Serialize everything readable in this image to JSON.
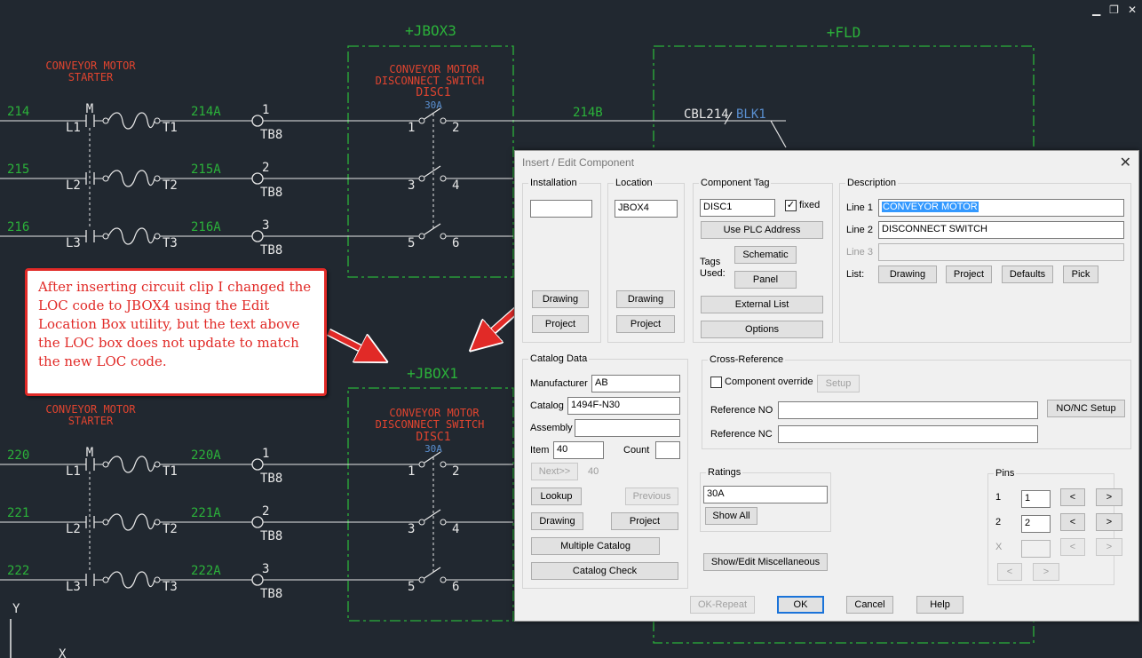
{
  "window_controls": {
    "minimize": "▁",
    "restore": "❐",
    "close": "✕"
  },
  "cad": {
    "rung_labels": [
      "CONVEYOR MOTOR",
      "STARTER"
    ],
    "box_names": {
      "jbox3": "+JBOX3",
      "fld": "+FLD",
      "jbox1": "+JBOX1"
    },
    "disc_labels": [
      "CONVEYOR MOTOR",
      "DISCONNECT SWITCH"
    ],
    "disc_tag": "DISC1",
    "rating": "30A",
    "cable_label": "CBL214",
    "wire_color": "BLK1",
    "wire_214b": "214B",
    "contactor_tag": "M",
    "top_wires": [
      "214",
      "215",
      "216"
    ],
    "top_wires_a": [
      "214A",
      "215A",
      "216A"
    ],
    "bot_wires": [
      "220",
      "221",
      "222"
    ],
    "bot_wires_a": [
      "220A",
      "221A",
      "222A"
    ],
    "line_terms": [
      "L1",
      "L2",
      "L3"
    ],
    "load_terms": [
      "T1",
      "T2",
      "T3"
    ],
    "tb_nums": [
      "1",
      "2",
      "3"
    ],
    "tb_name": "TB8",
    "pole_in": [
      "1",
      "3",
      "5"
    ],
    "pole_out": [
      "2",
      "4",
      "6"
    ],
    "ucs_y": "Y",
    "ucs_x": "X"
  },
  "callout_text": "After inserting circuit clip I changed the LOC code to JBOX4 using the Edit Location Box utility, but the text above the LOC box does not update to match the new LOC code.",
  "dialog": {
    "title": "Insert / Edit Component",
    "close": "✕",
    "installation": {
      "label": "Installation",
      "value": "",
      "drawing": "Drawing",
      "project": "Project"
    },
    "location": {
      "label": "Location",
      "value": "JBOX4",
      "drawing": "Drawing",
      "project": "Project"
    },
    "component_tag": {
      "label": "Component Tag",
      "value": "DISC1",
      "fixed_label": "fixed",
      "fixed_mark": "✓",
      "use_plc": "Use PLC Address",
      "tags_used": "Tags Used:",
      "schematic": "Schematic",
      "panel": "Panel",
      "external_list": "External List",
      "options": "Options"
    },
    "description": {
      "label": "Description",
      "line1_label": "Line 1",
      "line1": "CONVEYOR MOTOR",
      "line2_label": "Line 2",
      "line2": "DISCONNECT SWITCH",
      "line3_label": "Line 3",
      "line3": "",
      "list_label": "List:",
      "drawing": "Drawing",
      "project": "Project",
      "defaults": "Defaults",
      "pick": "Pick"
    },
    "catalog": {
      "label": "Catalog Data",
      "manufacturer_label": "Manufacturer",
      "manufacturer": "AB",
      "catalog_label": "Catalog",
      "catalog": "1494F-N30",
      "assembly_label": "Assembly",
      "assembly": "",
      "item_label": "Item",
      "item": "40",
      "count_label": "Count",
      "count": "",
      "next": "Next>>",
      "next_value": "40",
      "lookup": "Lookup",
      "previous": "Previous",
      "drawing": "Drawing",
      "project": "Project",
      "multiple": "Multiple Catalog",
      "check": "Catalog Check"
    },
    "crossref": {
      "label": "Cross-Reference",
      "override_label": "Component override",
      "setup": "Setup",
      "ref_no_label": "Reference NO",
      "ref_no": "",
      "nonc_setup": "NO/NC Setup",
      "ref_nc_label": "Reference NC",
      "ref_nc": ""
    },
    "ratings": {
      "label": "Ratings",
      "value": "30A",
      "show_all": "Show All"
    },
    "misc": "Show/Edit Miscellaneous",
    "pins": {
      "label": "Pins",
      "row1_label": "1",
      "row1": "1",
      "row2_label": "2",
      "row2": "2",
      "row3_label": "X",
      "row3": "",
      "lt": "<",
      "gt": ">"
    },
    "footer": {
      "ok_repeat": "OK-Repeat",
      "ok": "OK",
      "cancel": "Cancel",
      "help": "Help"
    }
  }
}
